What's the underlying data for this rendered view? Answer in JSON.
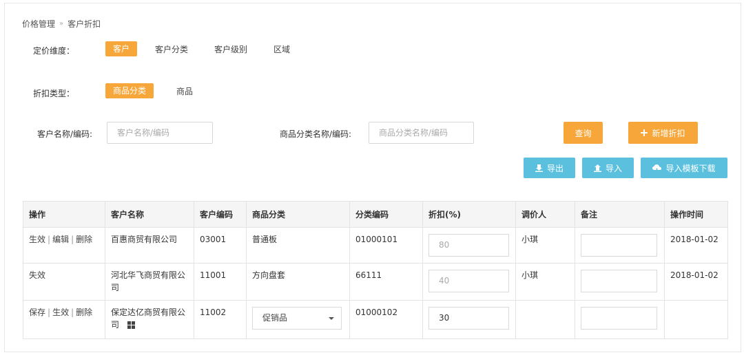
{
  "breadcrumb": {
    "parent": "价格管理",
    "separator": "»",
    "current": "客户折扣"
  },
  "pricing_dimension": {
    "label": "定价维度：",
    "options": [
      "客户",
      "客户分类",
      "客户级别",
      "区域"
    ],
    "active": "客户"
  },
  "discount_type": {
    "label": "折扣类型：",
    "options": [
      "商品分类",
      "商品"
    ],
    "active": "商品分类"
  },
  "search": {
    "customer_label": "客户名称/编码:",
    "customer_placeholder": "客户名称/编码",
    "category_label": "商品分类名称/编码:",
    "category_placeholder": "商品分类名称/编码"
  },
  "buttons": {
    "query": "查询",
    "add_discount": "新增折扣",
    "export": "导出",
    "import": "导入",
    "import_template": "导入模板下载"
  },
  "table": {
    "headers": [
      "操作",
      "客户名称",
      "客户编码",
      "商品分类",
      "分类编码",
      "折扣(%)",
      "调价人",
      "备注",
      "操作时间"
    ],
    "rows": [
      {
        "ops": [
          "生效",
          "编辑",
          "删除"
        ],
        "customer_name": "百惠商贸有限公司",
        "customer_code": "03001",
        "category": "普通板",
        "category_code": "01000101",
        "discount": "80",
        "adjuster": "小琪",
        "remark": "",
        "time": "2018-01-02"
      },
      {
        "ops": [
          "失效"
        ],
        "customer_name": "河北华飞商贸有限公司",
        "customer_code": "11001",
        "category": "方向盘套",
        "category_code": "66111",
        "discount": "40",
        "adjuster": "小琪",
        "remark": "",
        "time": "2018-01-02"
      },
      {
        "ops": [
          "保存",
          "生效",
          "删除"
        ],
        "customer_name": "保定达亿商贸有限公司",
        "customer_code": "11002",
        "category": "促销品",
        "category_code": "01000102",
        "discount": "30",
        "adjuster": "",
        "remark": "",
        "time": ""
      }
    ]
  },
  "colors": {
    "accent_orange": "#f7a73a",
    "accent_blue": "#5bc0de"
  }
}
